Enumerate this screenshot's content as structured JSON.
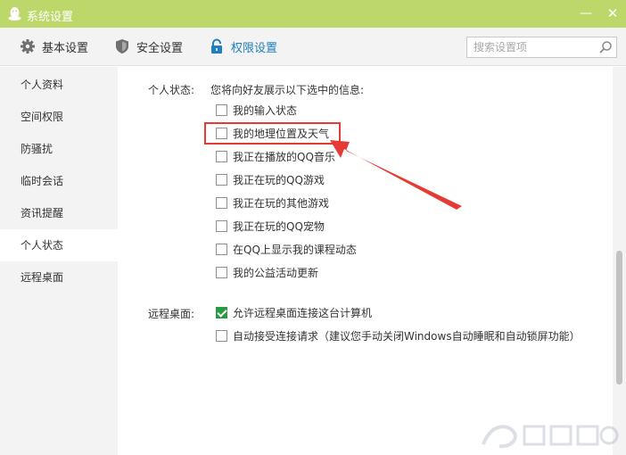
{
  "window": {
    "title": "系统设置",
    "minimize_glyph": "—",
    "close_glyph": "✕",
    "titlebar_color": "#bcd86a"
  },
  "toolbar": {
    "tabs": [
      {
        "label": "基本设置",
        "icon": "gear-icon"
      },
      {
        "label": "安全设置",
        "icon": "shield-icon"
      },
      {
        "label": "权限设置",
        "icon": "lock-icon",
        "active": true
      }
    ],
    "search": {
      "placeholder": "搜索设置项",
      "value": ""
    }
  },
  "sidebar": {
    "items": [
      {
        "label": "个人资料"
      },
      {
        "label": "空间权限"
      },
      {
        "label": "防骚扰"
      },
      {
        "label": "临时会话"
      },
      {
        "label": "资讯提醒"
      },
      {
        "label": "个人状态",
        "active": true
      },
      {
        "label": "远程桌面"
      }
    ]
  },
  "personal_status": {
    "label": "个人状态:",
    "description": "您将向好友展示以下选中的信息:",
    "options": [
      {
        "label": "我的输入状态",
        "checked": false
      },
      {
        "label": "我的地理位置及天气",
        "checked": false,
        "highlighted": true
      },
      {
        "label": "我正在播放的QQ音乐",
        "checked": false
      },
      {
        "label": "我正在玩的QQ游戏",
        "checked": false
      },
      {
        "label": "我正在玩的其他游戏",
        "checked": false
      },
      {
        "label": "我正在玩的QQ宠物",
        "checked": false
      },
      {
        "label": "在QQ上显示我的课程动态",
        "checked": false
      },
      {
        "label": "我的公益活动更新",
        "checked": false
      }
    ]
  },
  "remote_desktop": {
    "label": "远程桌面:",
    "options": [
      {
        "label": "允许远程桌面连接这台计算机",
        "checked": true
      },
      {
        "label": "自动接受连接请求（建议您手动关闭Windows自动睡眠和自动锁屏功能）",
        "checked": false
      }
    ]
  },
  "annotation_color": "#e63a35",
  "accent_color": "#1f7fc0"
}
